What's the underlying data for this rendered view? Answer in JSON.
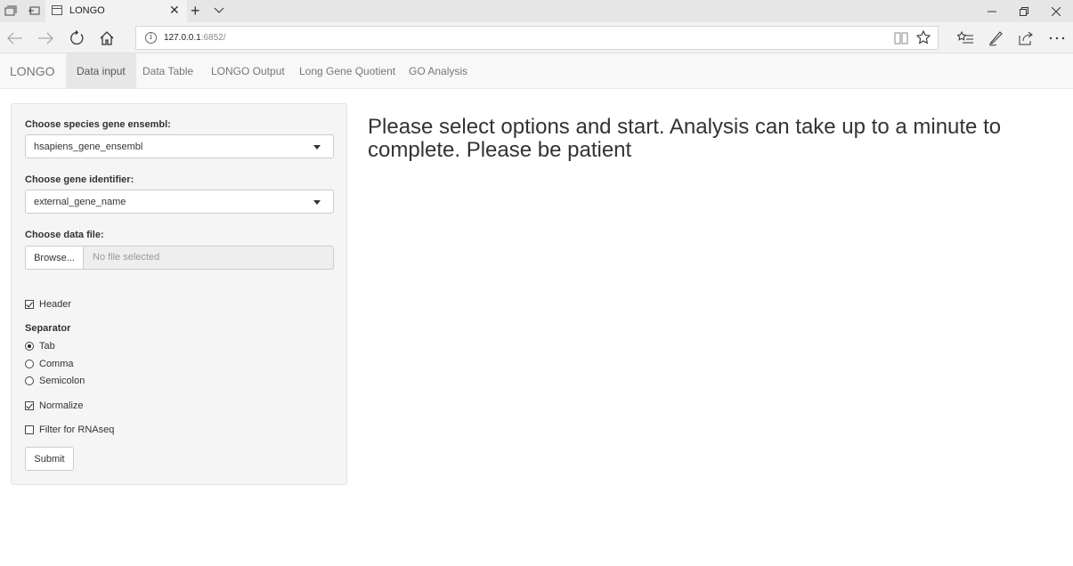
{
  "browser": {
    "tab_title": "LONGO",
    "url_host": "127.0.0.1",
    "url_port": ":6852/"
  },
  "app": {
    "brand": "LONGO",
    "tabs": [
      {
        "label": "Data input",
        "active": true
      },
      {
        "label": "Data Table",
        "active": false
      },
      {
        "label": "LONGO Output",
        "active": false
      },
      {
        "label": "Long Gene Quotient",
        "active": false
      },
      {
        "label": "GO Analysis",
        "active": false
      }
    ]
  },
  "sidebar": {
    "species_label": "Choose species gene ensembl:",
    "species_value": "hsapiens_gene_ensembl",
    "identifier_label": "Choose gene identifier:",
    "identifier_value": "external_gene_name",
    "file_label": "Choose data file:",
    "browse_label": "Browse...",
    "file_placeholder": "No file selected",
    "header_label": "Header",
    "header_checked": true,
    "separator_label": "Separator",
    "separator_options": [
      {
        "label": "Tab",
        "checked": true
      },
      {
        "label": "Comma",
        "checked": false
      },
      {
        "label": "Semicolon",
        "checked": false
      }
    ],
    "normalize_label": "Normalize",
    "normalize_checked": true,
    "filter_label": "Filter for RNAseq",
    "filter_checked": false,
    "submit_label": "Submit"
  },
  "main": {
    "message": "Please select options and start. Analysis can take up to a minute to complete. Please be patient"
  }
}
